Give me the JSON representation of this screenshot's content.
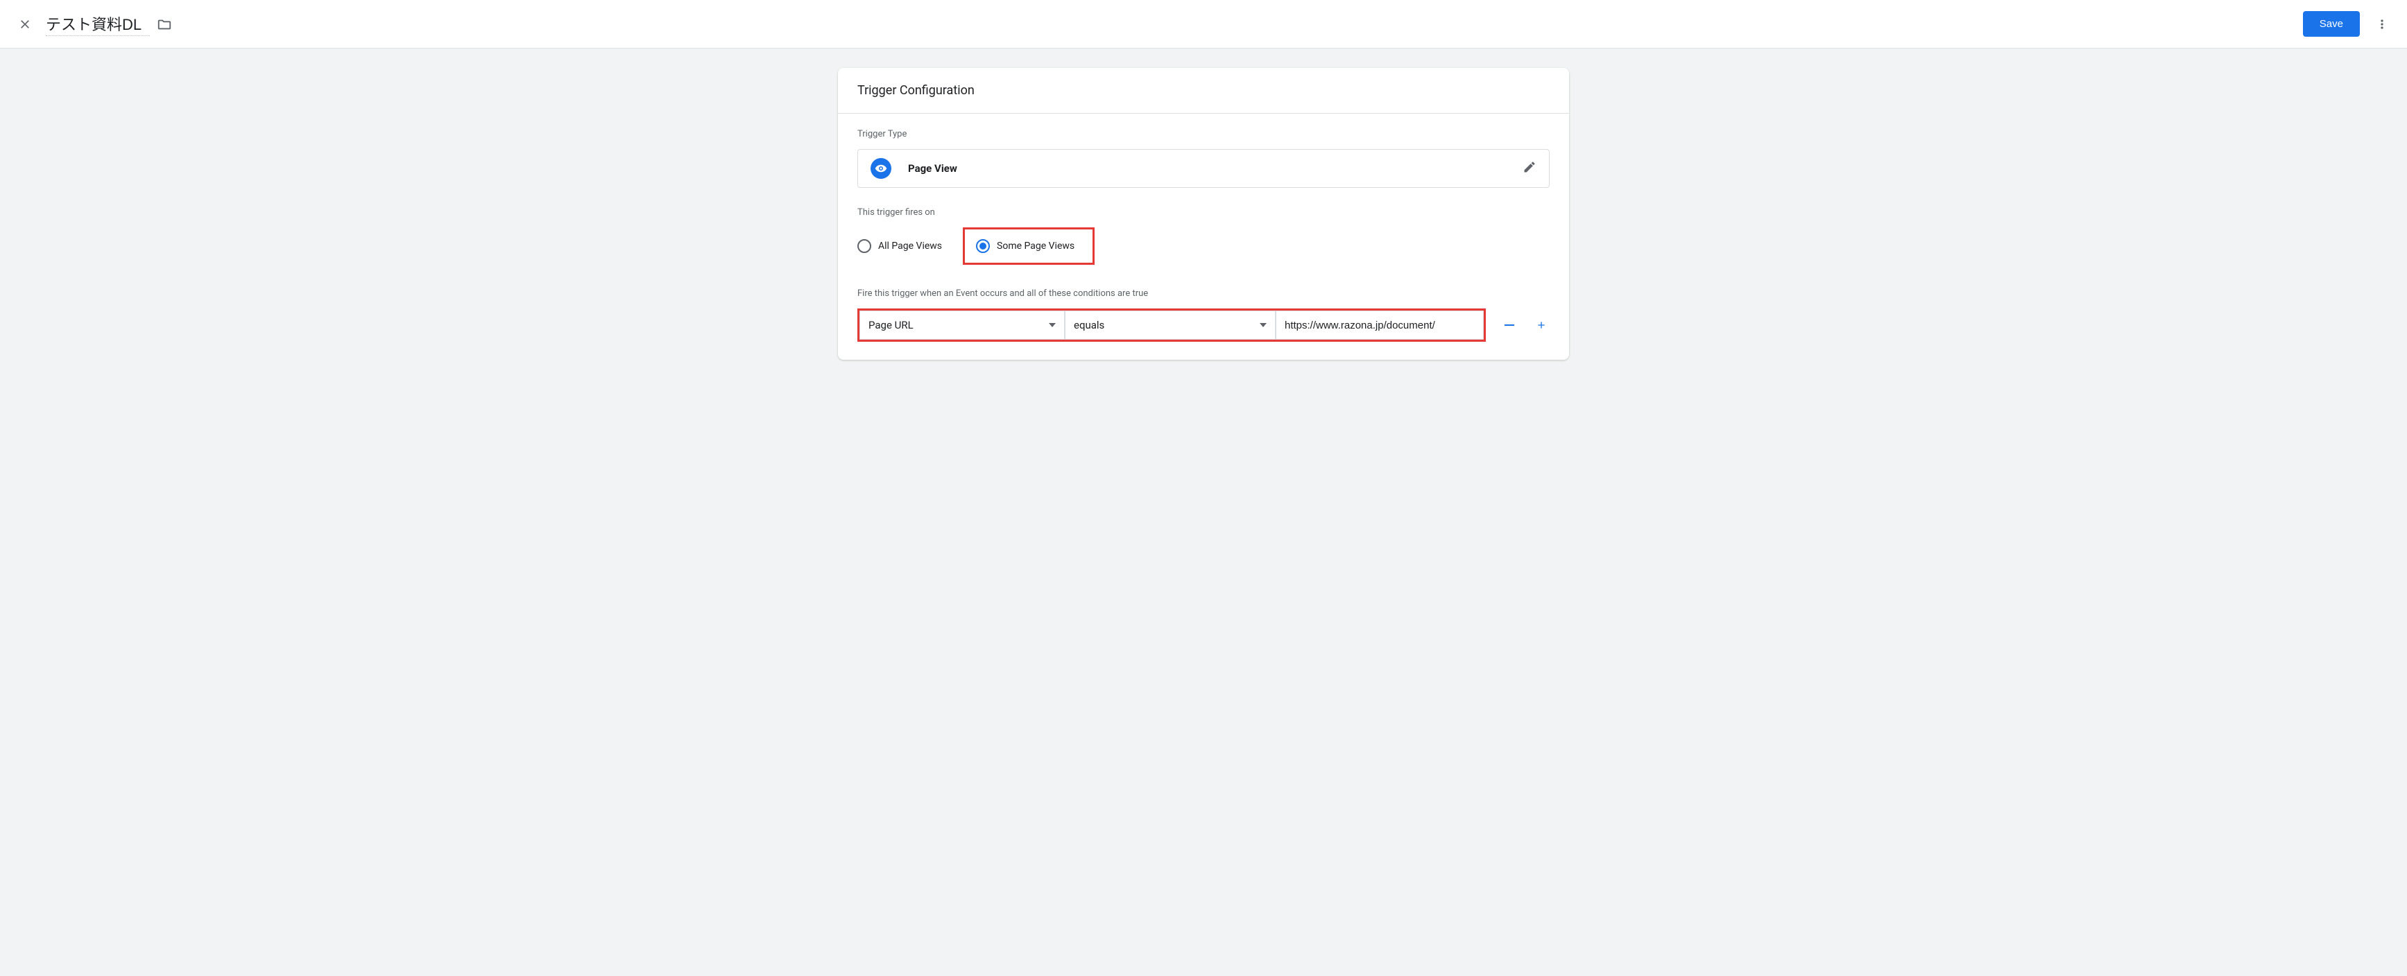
{
  "header": {
    "title": "テスト資料DL",
    "save_label": "Save"
  },
  "card": {
    "title": "Trigger Configuration",
    "trigger_type_label": "Trigger Type",
    "trigger_type_name": "Page View",
    "fires_on_label": "This trigger fires on",
    "radio": {
      "all": "All Page Views",
      "some": "Some Page Views",
      "selected": "some"
    },
    "conditions_label": "Fire this trigger when an Event occurs and all of these conditions are true",
    "condition": {
      "variable": "Page URL",
      "operator": "equals",
      "value": "https://www.razona.jp/document/"
    }
  }
}
